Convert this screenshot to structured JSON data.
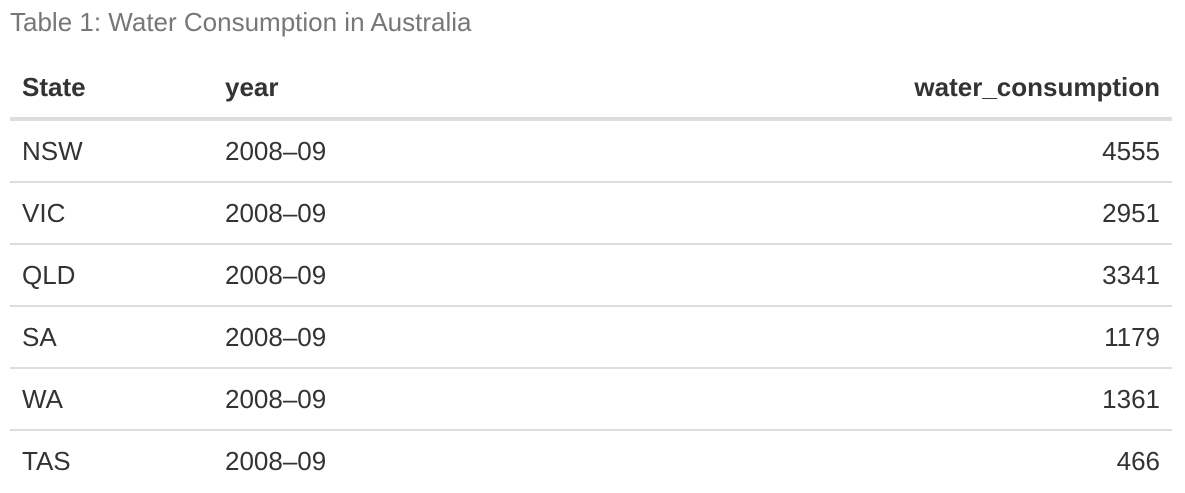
{
  "caption": "Table 1: Water Consumption in Australia",
  "table": {
    "columns": [
      "State",
      "year",
      "water_consumption"
    ],
    "rows": [
      {
        "state": "NSW",
        "year": "2008–09",
        "water_consumption": "4555"
      },
      {
        "state": "VIC",
        "year": "2008–09",
        "water_consumption": "2951"
      },
      {
        "state": "QLD",
        "year": "2008–09",
        "water_consumption": "3341"
      },
      {
        "state": "SA",
        "year": "2008–09",
        "water_consumption": "1179"
      },
      {
        "state": "WA",
        "year": "2008–09",
        "water_consumption": "1361"
      },
      {
        "state": "TAS",
        "year": "2008–09",
        "water_consumption": "466"
      }
    ]
  }
}
